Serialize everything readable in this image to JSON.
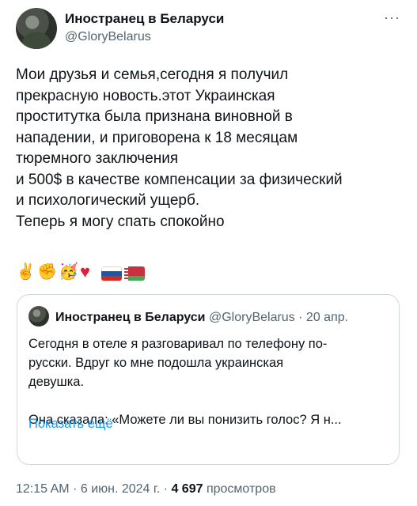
{
  "author": {
    "name": "Иностранец в Беларуси",
    "handle": "@GloryBelarus",
    "more_icon": "···"
  },
  "tweet": {
    "text": "Мои друзья и семья,сегодня я получил\nпрекрасную новость.этот Украинская\nпроститутка была признана виновной в\nнападении, и приговорена к 18 месяцам\nтюремного заключения\nи 500$ в качестве компенсации за физический\nи психологический ущерб.\nТеперь я могу спать спокойно",
    "emojis": {
      "victory": "✌️",
      "fist": "✊",
      "party": "🥳",
      "heart": "♥",
      "flag_ru_colors": [
        "#ffffff",
        "#1c57a7",
        "#d52b1e"
      ],
      "flag_by_colors": [
        "#c8313e",
        "#4aa657"
      ]
    }
  },
  "quoted": {
    "name": "Иностранец в Беларуси",
    "handle": "@GloryBelarus",
    "separator": "·",
    "date": "20 апр.",
    "text": "Сегодня в отеле я разговаривал по телефону по-\nрусски. Вдруг ко мне подошла украинская\nдевушка.\n\nОна сказала: «Можете ли вы понизить голос? Я н...",
    "show_more": "Показать ещё"
  },
  "meta": {
    "time": "12:15 AM",
    "separator": "·",
    "date": "6 июн. 2024 г.",
    "views_count": "4 697",
    "views_label": "просмотров"
  }
}
